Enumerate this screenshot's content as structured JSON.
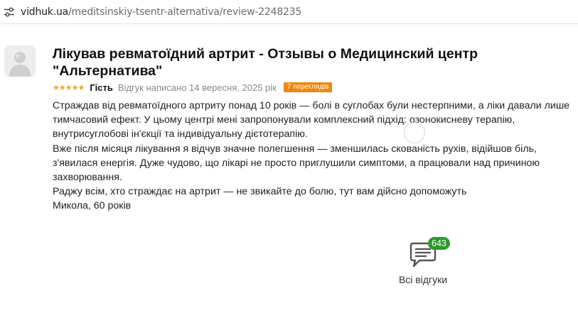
{
  "browser": {
    "url_host": "vidhuk.ua",
    "url_path": "/meditsinskiy-tsentr-alternativa/review-2248235",
    "site_info_icon": "tune-icon"
  },
  "review": {
    "title": "Лікував ревматоїдний артрит - Отзывы о Медицинский центр \"Альтернатива\"",
    "stars": "★★★★★",
    "rating": 5,
    "author": "Гість",
    "date_text": "Відгук написано 14 вересня, 2025 рік",
    "views_text": "7 переглядів",
    "paragraphs": [
      "Страждав від ревматоїдного артриту понад 10 років — болі в суглобах були нестерпними, а ліки давали лише тимчасовий ефект. У цьому центрі мені запропонували комплексний підхід: озонокисневу терапію, внутрисуглобові ін'єкції та індивідуальну дієтотерапію.",
      "Вже після місяця лікування я відчув значне полегшення — зменшилась скованість рухів, відійшов біль, з'явилася енергія. Дуже чудово, що лікарі не просто приглушили симптоми, а працювали над причиною захворювання.",
      "Раджу всім, хто страждає на артрит — не звикайте до болю, тут вам дійсно допоможуть",
      "Микола, 60 років"
    ]
  },
  "all_reviews": {
    "count": "643",
    "label": "Всі відгуки",
    "icon": "chat-bubble-icon"
  },
  "colors": {
    "star": "#f2a31b",
    "views_badge": "#f0870e",
    "count_badge": "#2d9a2d"
  }
}
